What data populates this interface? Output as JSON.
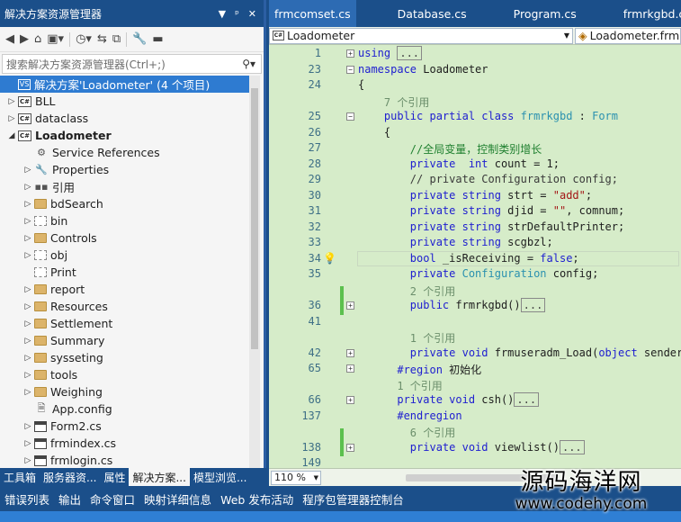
{
  "solution_explorer": {
    "title": "解决方案资源管理器",
    "title_buttons": [
      "▼",
      "ᵖ",
      "✕"
    ],
    "search_placeholder": "搜索解决方案资源管理器(Ctrl+;)",
    "tree": [
      {
        "label": "解决方案'Loadometer' (4 个项目)",
        "icon": "solution-icon",
        "arrow": "",
        "indent": 0,
        "selected": true
      },
      {
        "label": "BLL",
        "icon": "csharp-project-icon",
        "arrow": "▷",
        "indent": 0
      },
      {
        "label": "dataclass",
        "icon": "csharp-project-icon",
        "arrow": "▷",
        "indent": 0
      },
      {
        "label": "Loadometer",
        "icon": "csharp-project-icon",
        "arrow": "◢",
        "indent": 0,
        "bold": true
      },
      {
        "label": "Service References",
        "icon": "service-references-icon",
        "arrow": "",
        "indent": 1
      },
      {
        "label": "Properties",
        "icon": "wrench-icon",
        "arrow": "▷",
        "indent": 1
      },
      {
        "label": "引用",
        "icon": "references-icon",
        "arrow": "▷",
        "indent": 1
      },
      {
        "label": "bdSearch",
        "icon": "folder-icon",
        "arrow": "▷",
        "indent": 1
      },
      {
        "label": "bin",
        "icon": "folder-dotted-icon",
        "arrow": "▷",
        "indent": 1
      },
      {
        "label": "Controls",
        "icon": "folder-icon",
        "arrow": "▷",
        "indent": 1
      },
      {
        "label": "obj",
        "icon": "folder-dotted-icon",
        "arrow": "▷",
        "indent": 1
      },
      {
        "label": "Print",
        "icon": "folder-dotted-icon",
        "arrow": "",
        "indent": 1
      },
      {
        "label": "report",
        "icon": "folder-icon",
        "arrow": "▷",
        "indent": 1
      },
      {
        "label": "Resources",
        "icon": "folder-icon",
        "arrow": "▷",
        "indent": 1
      },
      {
        "label": "Settlement",
        "icon": "folder-icon",
        "arrow": "▷",
        "indent": 1
      },
      {
        "label": "Summary",
        "icon": "folder-icon",
        "arrow": "▷",
        "indent": 1
      },
      {
        "label": "sysseting",
        "icon": "folder-icon",
        "arrow": "▷",
        "indent": 1
      },
      {
        "label": "tools",
        "icon": "folder-icon",
        "arrow": "▷",
        "indent": 1
      },
      {
        "label": "Weighing",
        "icon": "folder-icon",
        "arrow": "▷",
        "indent": 1
      },
      {
        "label": "App.config",
        "icon": "config-file-icon",
        "arrow": "",
        "indent": 1
      },
      {
        "label": "Form2.cs",
        "icon": "form-file-icon",
        "arrow": "▷",
        "indent": 1
      },
      {
        "label": "frmindex.cs",
        "icon": "form-file-icon",
        "arrow": "▷",
        "indent": 1
      },
      {
        "label": "frmlogin.cs",
        "icon": "form-file-icon",
        "arrow": "▷",
        "indent": 1
      }
    ],
    "bottom_tabs": [
      {
        "label": "工具箱",
        "active": false
      },
      {
        "label": "服务器资...",
        "active": false
      },
      {
        "label": "属性",
        "active": false
      },
      {
        "label": "解决方案...",
        "active": true
      },
      {
        "label": "模型浏览...",
        "active": false
      }
    ]
  },
  "editor": {
    "tabs": [
      "frmcomset.cs",
      "Database.cs",
      "Program.cs",
      "frmrkgbd.cs"
    ],
    "nav_left": "Loadometer",
    "nav_right": "Loadometer.frm",
    "zoom": "110 %",
    "lines": [
      {
        "n": "1",
        "fold": "+",
        "html": [
          [
            "kw",
            "using "
          ],
          [
            "box",
            "..."
          ]
        ]
      },
      {
        "n": "23",
        "fold": "-",
        "html": [
          [
            "kw",
            "namespace"
          ],
          [
            "",
            " Loadometer"
          ]
        ]
      },
      {
        "n": "24",
        "html": [
          [
            "",
            "{"
          ]
        ]
      },
      {
        "n": "",
        "html": [
          [
            "ref",
            "    7 个引用"
          ]
        ]
      },
      {
        "n": "25",
        "fold": "-",
        "html": [
          [
            "kw",
            "    public partial class "
          ],
          [
            "ty",
            "frmrkgbd"
          ],
          [
            "",
            " : "
          ],
          [
            "ty",
            "Form"
          ]
        ]
      },
      {
        "n": "26",
        "html": [
          [
            "",
            "    {"
          ]
        ]
      },
      {
        "n": "27",
        "html": [
          [
            "cm",
            "        //全局变量，控制类别增长"
          ]
        ]
      },
      {
        "n": "28",
        "html": [
          [
            "kw",
            "        private  int"
          ],
          [
            "",
            " count = 1;"
          ]
        ]
      },
      {
        "n": "29",
        "html": [
          [
            "cmt",
            "        // private Configuration config;"
          ]
        ]
      },
      {
        "n": "30",
        "html": [
          [
            "kw",
            "        private string"
          ],
          [
            "",
            " strt = "
          ],
          [
            "st",
            "\"add\""
          ],
          [
            "",
            ";"
          ]
        ]
      },
      {
        "n": "31",
        "html": [
          [
            "kw",
            "        private string"
          ],
          [
            "",
            " djid = "
          ],
          [
            "st",
            "\"\""
          ],
          [
            "",
            ", comnum;"
          ]
        ]
      },
      {
        "n": "32",
        "html": [
          [
            "kw",
            "        private string"
          ],
          [
            "",
            " strDefaultPrinter;"
          ]
        ]
      },
      {
        "n": "33",
        "html": [
          [
            "kw",
            "        private string"
          ],
          [
            "",
            " scgbzl;"
          ]
        ]
      },
      {
        "n": "34",
        "bulb": true,
        "cur": true,
        "html": [
          [
            "kw",
            "        bool"
          ],
          [
            "",
            " _isReceiving = "
          ],
          [
            "kw",
            "false"
          ],
          [
            "",
            ";"
          ]
        ]
      },
      {
        "n": "35",
        "html": [
          [
            "kw",
            "        private "
          ],
          [
            "ty",
            "Configuration"
          ],
          [
            "",
            " config;"
          ]
        ]
      },
      {
        "n": "",
        "html": [
          [
            "ref",
            "        2 个引用"
          ]
        ]
      },
      {
        "n": "36",
        "fold": "+",
        "chg": true,
        "html": [
          [
            "kw",
            "        public"
          ],
          [
            "",
            " frmrkgbd()"
          ],
          [
            "box",
            "..."
          ]
        ]
      },
      {
        "n": "41",
        "html": [
          [
            "",
            ""
          ]
        ]
      },
      {
        "n": "",
        "html": [
          [
            "ref",
            "        1 个引用"
          ]
        ]
      },
      {
        "n": "42",
        "fold": "+",
        "html": [
          [
            "kw",
            "        private void"
          ],
          [
            "",
            " frmuseradm_Load("
          ],
          [
            "kw",
            "object"
          ],
          [
            "",
            " sender"
          ]
        ]
      },
      {
        "n": "65",
        "fold": "+",
        "html": [
          [
            "kw",
            "      #region"
          ],
          [
            "",
            " 初始化"
          ]
        ]
      },
      {
        "n": "",
        "html": [
          [
            "ref",
            "      1 个引用"
          ]
        ]
      },
      {
        "n": "66",
        "fold": "+",
        "html": [
          [
            "kw",
            "      private void"
          ],
          [
            "",
            " csh()"
          ],
          [
            "box",
            "..."
          ]
        ]
      },
      {
        "n": "137",
        "html": [
          [
            "kw",
            "      #endregion"
          ]
        ]
      },
      {
        "n": "",
        "html": [
          [
            "ref",
            "        6 个引用"
          ]
        ]
      },
      {
        "n": "138",
        "fold": "+",
        "chg": true,
        "html": [
          [
            "kw",
            "        private void"
          ],
          [
            "",
            " viewlist()"
          ],
          [
            "box",
            "..."
          ]
        ]
      },
      {
        "n": "149",
        "html": [
          [
            "",
            ""
          ]
        ]
      }
    ]
  },
  "bottom_tabs": [
    "错误列表",
    "输出",
    "命令窗口",
    "映射详细信息",
    "Web 发布活动",
    "程序包管理器控制台"
  ],
  "watermark": {
    "line1": "源码海洋网",
    "line2": "www.codehy.com"
  },
  "colors": {
    "accent": "#1b4f8a",
    "selection": "#2e7bd1",
    "editor_bg": "#d6ecc9",
    "change_bar": "#5cc04e"
  }
}
